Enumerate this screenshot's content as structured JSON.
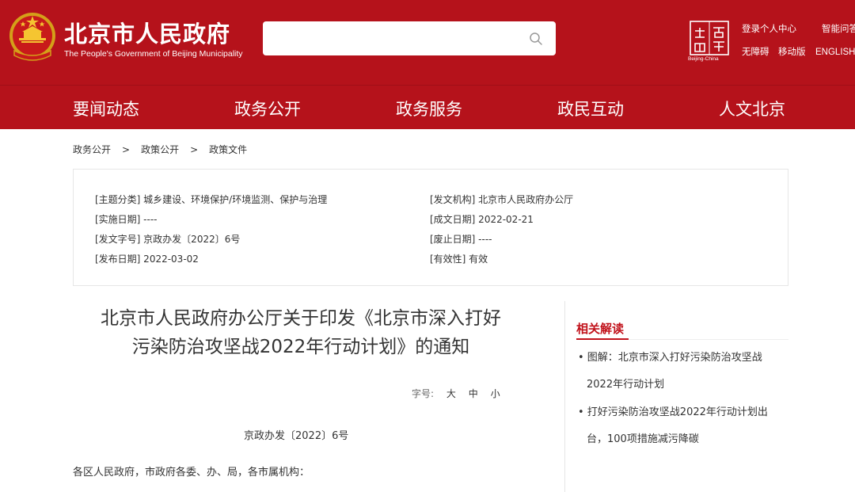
{
  "header": {
    "brand_cn": "北京市人民政府",
    "brand_en": "The People's Government of Beijing Municipality",
    "search_placeholder": "",
    "capital_cap": "Beijing-China",
    "links": {
      "login": "登录个人中心",
      "smart_qa": "智能问答",
      "accessible": "无障碍",
      "mobile": "移动版",
      "english": "ENGLISH"
    },
    "colors": {
      "brand_red": "#b5121b",
      "accent_red": "#c1121b"
    }
  },
  "nav": {
    "items": [
      "要闻动态",
      "政务公开",
      "政务服务",
      "政民互动",
      "人文北京"
    ]
  },
  "breadcrumb": [
    "政务公开",
    "政策公开",
    "政策文件"
  ],
  "breadcrumb_sep": ">",
  "meta": {
    "topic": "[主题分类] 城乡建设、环境保护/环境监测、保护与治理",
    "impl_date": "[实施日期] ----",
    "doc_no": "[发文字号] 京政办发〔2022〕6号",
    "pub_date": "[发布日期] 2022-03-02",
    "issuer": "[发文机构] 北京市人民政府办公厅",
    "written_date": "[成文日期] 2022-02-21",
    "abolish_date": "[废止日期] ----",
    "validity": "[有效性] 有效"
  },
  "article": {
    "title_line1": "北京市人民政府办公厅关于印发《北京市深入打好",
    "title_line2": "污染防治攻坚战2022年行动计划》的通知",
    "fontsize_label": "字号:",
    "fontsize_options": [
      "大",
      "中",
      "小"
    ],
    "doc_number": "京政办发〔2022〕6号",
    "recipients": "各区人民政府，市政府各委、办、局，各市属机构："
  },
  "related": {
    "title": "相关解读",
    "items": [
      {
        "line1": "• 图解：北京市深入打好污染防治攻坚战",
        "line2": "2022年行动计划"
      },
      {
        "line1": "• 打好污染防治攻坚战2022年行动计划出",
        "line2": "台，100项措施减污降碳"
      }
    ]
  }
}
